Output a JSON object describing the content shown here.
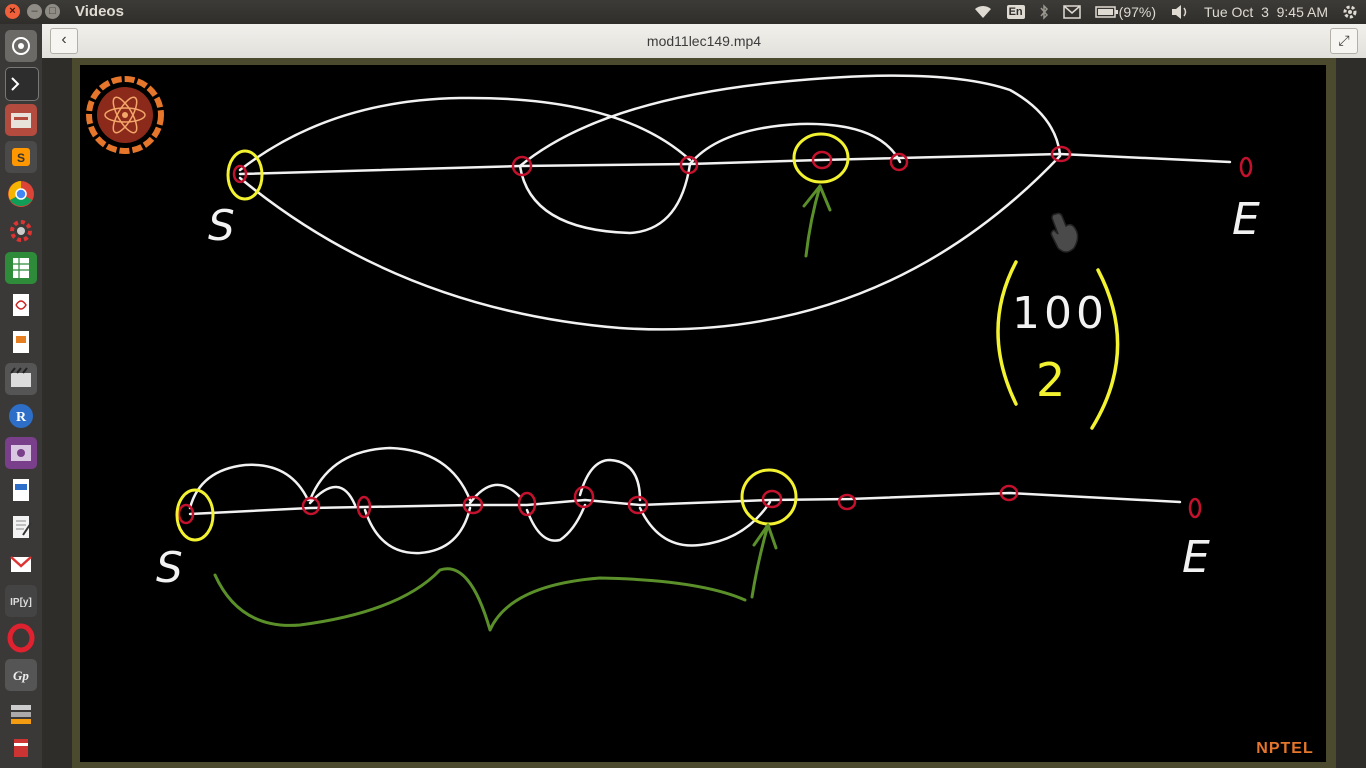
{
  "window": {
    "app_title": "Videos",
    "close_glyph": "×",
    "minimize_glyph": "–",
    "maximize_glyph": "□"
  },
  "indicators": {
    "language": "En",
    "battery": "(97%)",
    "clock": "Tue Oct  3  9:45 AM"
  },
  "header": {
    "file_title": "mod11lec149.mp4",
    "back_glyph": "‹",
    "fullscreen_glyph": "⤢"
  },
  "launcher": {
    "items": [
      "dash-home",
      "terminal",
      "files-archive",
      "sublime-text",
      "chrome",
      "settings-gear",
      "spreadsheet",
      "pdf-reader",
      "presentation",
      "video-editor",
      "r-lang",
      "media-player",
      "writer",
      "text-editor",
      "gmail",
      "ipython",
      "opera",
      "gnome-pie",
      "stack",
      "recycle"
    ]
  },
  "board": {
    "top_start_label": "S",
    "top_end_label": "E",
    "bottom_start_label": "S",
    "bottom_end_label": "E",
    "binom_top": "100",
    "binom_bottom": "2",
    "logo_text": "NPTEL"
  },
  "colors": {
    "chalk_white": "#f2f2f2",
    "chalk_yellow": "#f2f230",
    "chalk_red": "#c4122e",
    "chalk_green": "#5a8f2a",
    "nptel_orange": "#e5762b"
  }
}
